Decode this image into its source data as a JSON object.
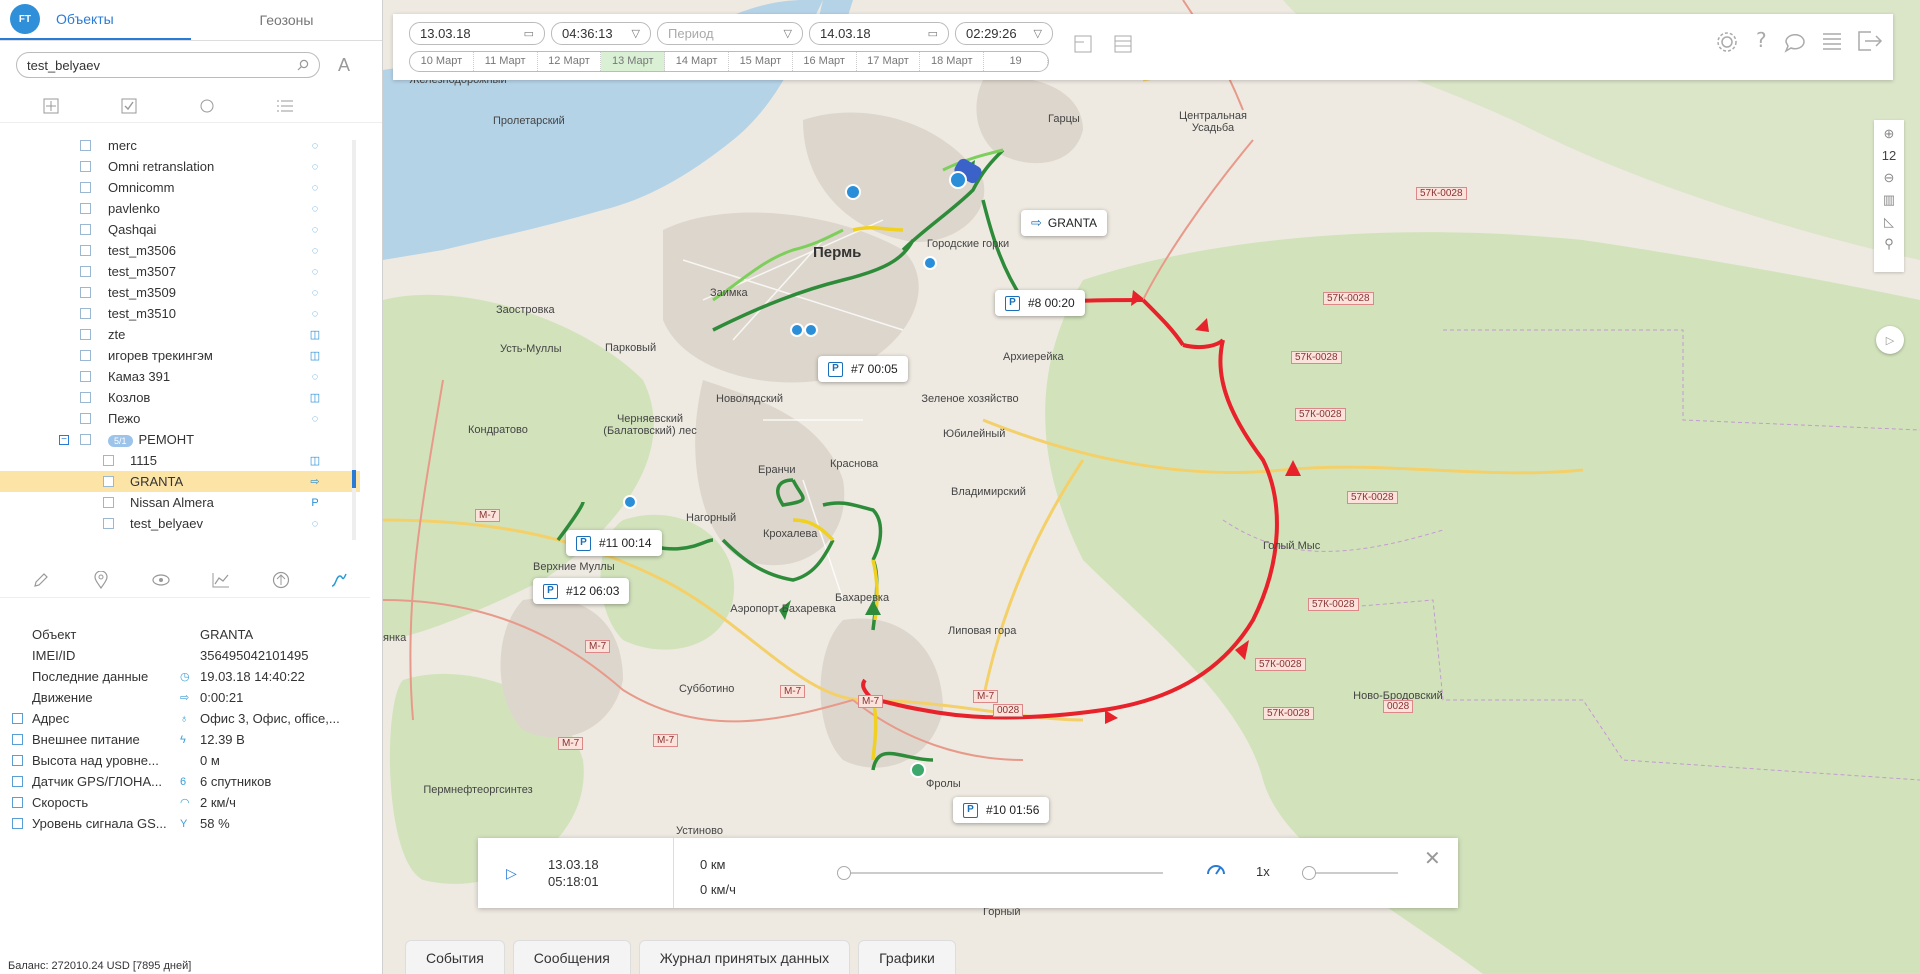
{
  "sidebar": {
    "logo": "FT",
    "tabs": [
      {
        "label": "Объекты"
      },
      {
        "label": "Геозоны"
      }
    ],
    "search": {
      "value": "test_belyaev"
    },
    "tree": [
      {
        "name": "merc",
        "level": 1
      },
      {
        "name": "Omni retranslation",
        "level": 1
      },
      {
        "name": "Omnicomm",
        "level": 1
      },
      {
        "name": "pavlenko",
        "level": 1
      },
      {
        "name": "Qashqai",
        "level": 1
      },
      {
        "name": "test_m3506",
        "level": 1
      },
      {
        "name": "test_m3507",
        "level": 1
      },
      {
        "name": "test_m3509",
        "level": 1
      },
      {
        "name": "test_m3510",
        "level": 1
      },
      {
        "name": "zte",
        "level": 1
      },
      {
        "name": "игорев трекингэм",
        "level": 1
      },
      {
        "name": "Камаз 391",
        "level": 1
      },
      {
        "name": "Козлов",
        "level": 1
      },
      {
        "name": "Пежо",
        "level": 1
      },
      {
        "name": "РЕМОНТ",
        "level": 1,
        "badge": "5/1",
        "group": true
      },
      {
        "name": "1115",
        "level": 2
      },
      {
        "name": "GRANTA",
        "level": 2,
        "selected": true
      },
      {
        "name": "Nissan Almera",
        "level": 2
      },
      {
        "name": "test_belyaev",
        "level": 2
      }
    ],
    "props": [
      {
        "label": "Объект",
        "value": "GRANTA",
        "checkbox": false,
        "icon": ""
      },
      {
        "label": "IMEI/ID",
        "value": "356495042101495",
        "checkbox": false,
        "icon": ""
      },
      {
        "label": "Последние данные",
        "value": "19.03.18 14:40:22",
        "checkbox": false,
        "icon": "◷"
      },
      {
        "label": "Движение",
        "value": "0:00:21",
        "checkbox": false,
        "icon": "⇨"
      },
      {
        "label": "Адрес",
        "value": "Офис 3, Офис, office,...",
        "checkbox": true,
        "icon": "♁"
      },
      {
        "label": "Внешнее питание",
        "value": "12.39 В",
        "checkbox": true,
        "icon": "ϟ"
      },
      {
        "label": "Высота над уровне...",
        "value": "0 м",
        "checkbox": true,
        "icon": ""
      },
      {
        "label": "Датчик GPS/ГЛОНА...",
        "value": "6 спутников",
        "checkbox": true,
        "icon": "6"
      },
      {
        "label": "Скорость",
        "value": "2 км/ч",
        "checkbox": true,
        "icon": "◠"
      },
      {
        "label": "Уровень сигнала GS...",
        "value": "58 %",
        "checkbox": true,
        "icon": "Y"
      }
    ],
    "balance": "Баланс: 272010.24 USD [7895 дней]"
  },
  "timebar": {
    "date_from": "13.03.18",
    "time_from": "04:36:13",
    "period_placeholder": "Период",
    "date_to": "14.03.18",
    "time_to": "02:29:26",
    "days": [
      "10 Март",
      "11 Март",
      "12 Март",
      "13 Март",
      "14 Март",
      "15 Март",
      "16 Март",
      "17 Март",
      "18 Март",
      "19"
    ],
    "active_day": "13 Март"
  },
  "zoom": {
    "level": "12"
  },
  "map_labels": {
    "places": [
      {
        "text": "Железнодорожный"
      },
      {
        "text": "Пролетарский"
      },
      {
        "text": "Гарцы"
      },
      {
        "text": "Центральная Усадьба"
      },
      {
        "text": "Пермь",
        "city": true
      },
      {
        "text": "Городские горки"
      },
      {
        "text": "Заимка"
      },
      {
        "text": "Заостровка"
      },
      {
        "text": "Усть-Муллы"
      },
      {
        "text": "Парковый"
      },
      {
        "text": "Архиерейка"
      },
      {
        "text": "Новолядский"
      },
      {
        "text": "Зеленое хозяйство"
      },
      {
        "text": "Кондратово"
      },
      {
        "text": "Черняевский (Балатовский) лес"
      },
      {
        "text": "Юбилейный"
      },
      {
        "text": "Краснова"
      },
      {
        "text": "Еранчи"
      },
      {
        "text": "Нагорный"
      },
      {
        "text": "Владимирский"
      },
      {
        "text": "Крохалева"
      },
      {
        "text": "Голый Мыс"
      },
      {
        "text": "Верхние Муллы"
      },
      {
        "text": "Бахаревка"
      },
      {
        "text": "Аэропорт Бахаревка"
      },
      {
        "text": "Липовая гора"
      },
      {
        "text": "Субботино"
      },
      {
        "text": "Ново-Бродовский"
      },
      {
        "text": "Пермнефтеоргсинтез"
      },
      {
        "text": "Фролы"
      },
      {
        "text": "Устиново"
      },
      {
        "text": "Горный"
      },
      {
        "text": "янка"
      }
    ],
    "shields": [
      "57К-0028",
      "57К-0028",
      "57К-0028",
      "57К-0028",
      "57К-0028",
      "57К-0028",
      "57К-0028",
      "57К-0028",
      "М-7",
      "М-7",
      "М-7",
      "М-7",
      "М-7",
      "М-7",
      "М-7",
      "0028",
      "0028"
    ]
  },
  "callouts": [
    {
      "kind": "arrow",
      "text": "GRANTA"
    },
    {
      "kind": "p",
      "text": "#8 00:20"
    },
    {
      "kind": "p",
      "text": "#7 00:05"
    },
    {
      "kind": "p",
      "text": "#11 00:14"
    },
    {
      "kind": "p",
      "text": "#12 06:03"
    },
    {
      "kind": "p",
      "text": "#10 01:56"
    }
  ],
  "player": {
    "date": "13.03.18",
    "time": "05:18:01",
    "distance": "0 км",
    "speed_value": "0 км/ч",
    "multiplier": "1x"
  },
  "bottom_tabs": [
    {
      "label": "События"
    },
    {
      "label": "Сообщения"
    },
    {
      "label": "Журнал принятых данных"
    },
    {
      "label": "Графики"
    }
  ],
  "colors": {
    "accent": "#2a7bd6",
    "track_green": "#2e8b3a",
    "track_red": "#e8222a",
    "track_yellow": "#f0d020",
    "selected_row": "#fbe4a6"
  }
}
